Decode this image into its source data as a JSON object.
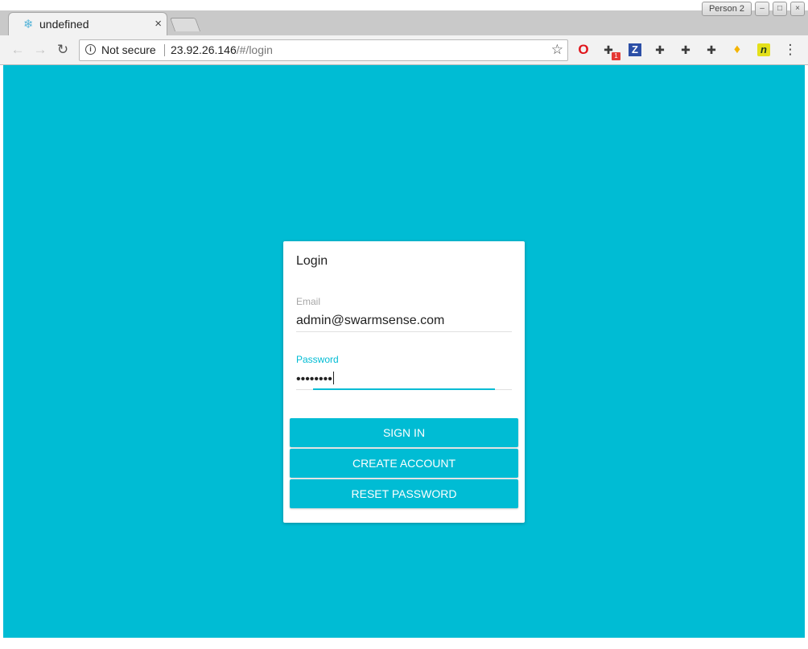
{
  "browser": {
    "profile_label": "Person 2",
    "tab": {
      "title": "undefined",
      "close_glyph": "×"
    },
    "security_label": "Not secure",
    "url_host": "23.92.26.146",
    "url_path": "/#/login",
    "extension_badge": "1",
    "extensions": [
      "opera-icon",
      "puzzle-icon",
      "z-icon",
      "puzzle-icon",
      "puzzle-icon",
      "puzzle-icon",
      "flame-icon",
      "n-icon"
    ]
  },
  "login": {
    "title": "Login",
    "email_label": "Email",
    "email_value": "admin@swarmsense.com",
    "password_label": "Password",
    "password_mask": "••••••••",
    "buttons": {
      "sign_in": "SIGN IN",
      "create_account": "CREATE ACCOUNT",
      "reset_password": "RESET PASSWORD"
    }
  },
  "colors": {
    "accent": "#00bcd4",
    "card": "#ffffff",
    "text": "#222222"
  }
}
